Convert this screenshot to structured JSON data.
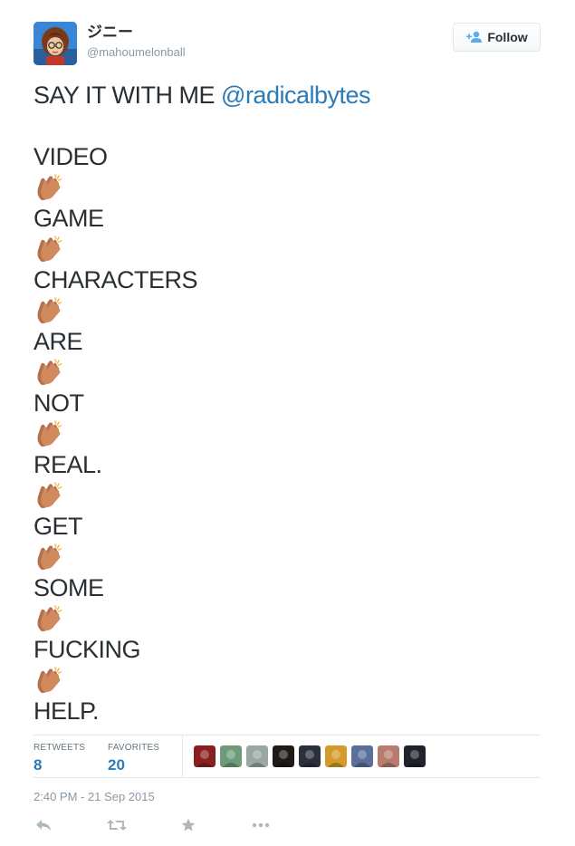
{
  "user": {
    "display_name": "ジニー",
    "handle": "@mahoumelonball",
    "avatar_icon": "cartoon-character-avatar"
  },
  "follow_button": {
    "label": "Follow",
    "icon": "add-person-icon"
  },
  "tweet": {
    "first_line_prefix": "SAY IT WITH ME ",
    "mention": "@radicalbytes",
    "words": [
      "VIDEO",
      "GAME",
      "CHARACTERS",
      "ARE",
      "NOT",
      "REAL.",
      "GET",
      "SOME",
      "FUCKING",
      "HELP."
    ],
    "separator_icon": "clapping-hands-icon"
  },
  "stats": {
    "retweets_label": "RETWEETS",
    "retweets_value": "8",
    "favorites_label": "FAVORITES",
    "favorites_value": "20"
  },
  "favoriters": [
    {
      "color": "#8a1f1f"
    },
    {
      "color": "#6f9b7a"
    },
    {
      "color": "#9aa7a3"
    },
    {
      "color": "#1e1a17"
    },
    {
      "color": "#2b2f3a"
    },
    {
      "color": "#d49a2a"
    },
    {
      "color": "#5a6f9a"
    },
    {
      "color": "#b77c6e"
    },
    {
      "color": "#20232c"
    }
  ],
  "timestamp": "2:40 PM - 21 Sep 2015",
  "actions": [
    "reply-icon",
    "retweet-icon",
    "favorite-icon",
    "more-icon"
  ],
  "colors": {
    "link": "#2b7bb9",
    "text": "#292f33",
    "muted": "#8899a6",
    "border": "#e1e8ed",
    "action_icon": "#aab8c2"
  }
}
